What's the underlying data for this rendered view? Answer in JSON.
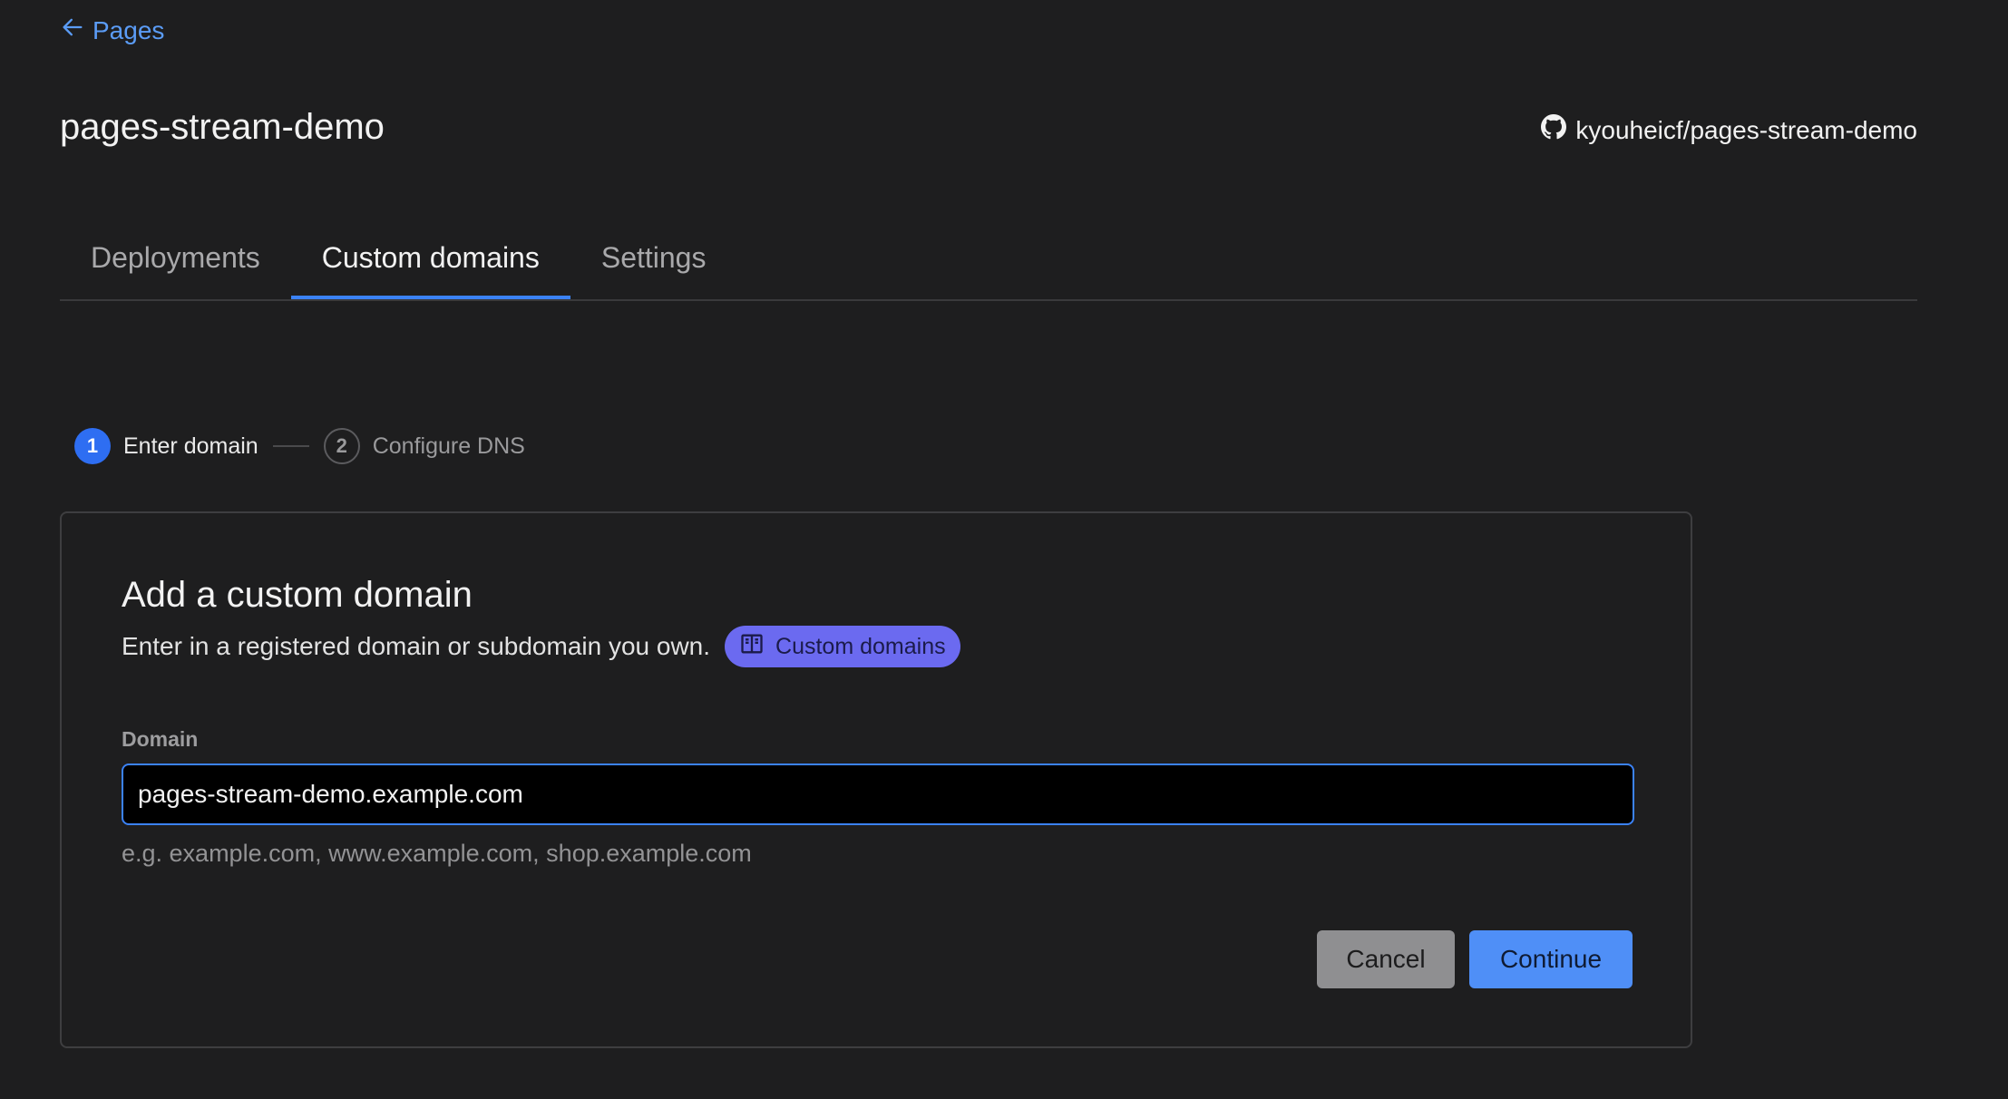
{
  "nav": {
    "back_label": "Pages"
  },
  "header": {
    "project_name": "pages-stream-demo",
    "repo": "kyouheicf/pages-stream-demo"
  },
  "tabs": [
    {
      "label": "Deployments",
      "active": false
    },
    {
      "label": "Custom domains",
      "active": true
    },
    {
      "label": "Settings",
      "active": false
    }
  ],
  "stepper": {
    "steps": [
      {
        "number": "1",
        "label": "Enter domain",
        "active": true
      },
      {
        "number": "2",
        "label": "Configure DNS",
        "active": false
      }
    ]
  },
  "card": {
    "title": "Add a custom domain",
    "description": "Enter in a registered domain or subdomain you own.",
    "doc_badge": "Custom domains",
    "field_label": "Domain",
    "input_value": "pages-stream-demo.example.com",
    "hint": "e.g. example.com, www.example.com, shop.example.com",
    "cancel_label": "Cancel",
    "continue_label": "Continue"
  },
  "colors": {
    "background": "#1e1e1f",
    "accent": "#3b82f6",
    "link": "#5b9cf6",
    "badge": "#6b6af0"
  }
}
